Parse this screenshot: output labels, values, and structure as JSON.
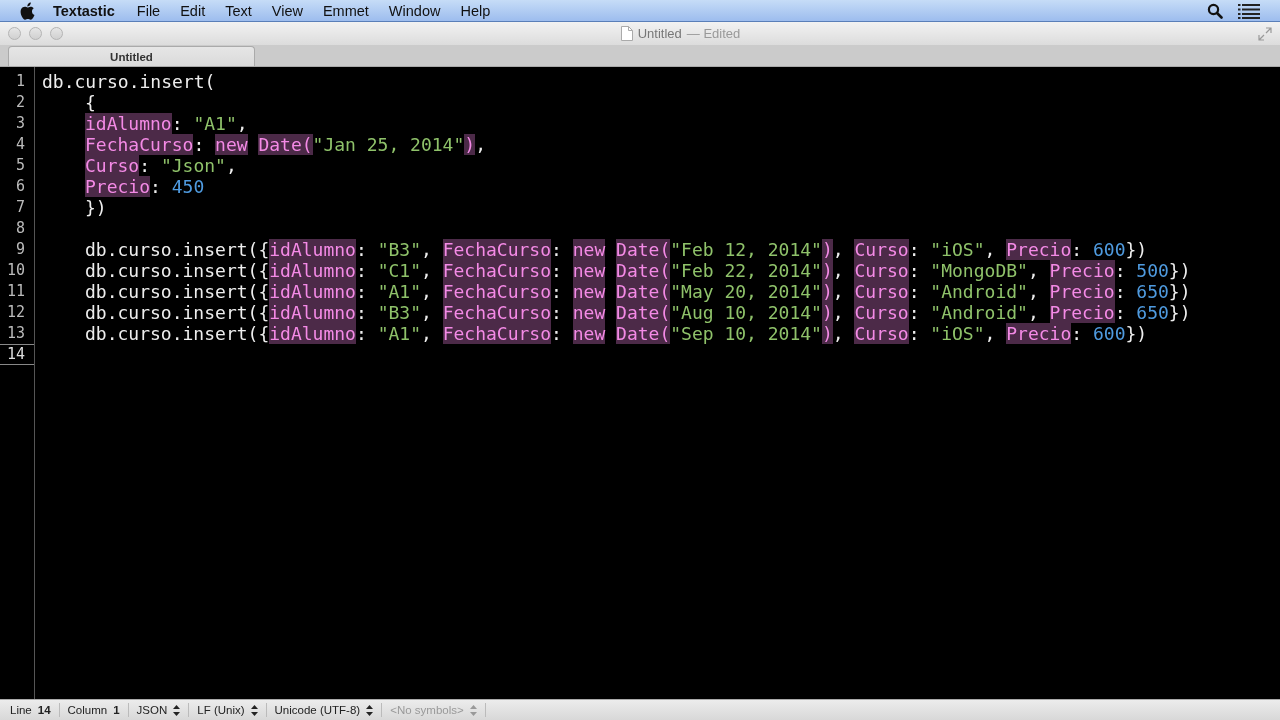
{
  "menu_bar": {
    "app_name": "Textastic",
    "menus": [
      "File",
      "Edit",
      "Text",
      "View",
      "Emmet",
      "Window",
      "Help"
    ]
  },
  "window": {
    "title": "Untitled",
    "title_status": "— Edited"
  },
  "tabs": [
    {
      "label": "Untitled",
      "selected": true
    }
  ],
  "editor": {
    "lines": [
      {
        "number": "1",
        "current": false,
        "indented": false,
        "tokens": [
          {
            "kind": "plain",
            "text": "db.curso.insert("
          }
        ]
      },
      {
        "number": "2",
        "current": false,
        "indented": true,
        "tokens": [
          {
            "kind": "plain",
            "text": "{"
          }
        ]
      },
      {
        "number": "3",
        "current": false,
        "indented": true,
        "tokens": [
          {
            "kind": "key",
            "text": "idAlumno"
          },
          {
            "kind": "plain",
            "text": ": "
          },
          {
            "kind": "string",
            "text": "\"A1\""
          },
          {
            "kind": "plain",
            "text": ","
          }
        ]
      },
      {
        "number": "4",
        "current": false,
        "indented": true,
        "tokens": [
          {
            "kind": "key",
            "text": "FechaCurso"
          },
          {
            "kind": "plain",
            "text": ": "
          },
          {
            "kind": "key",
            "text": "new"
          },
          {
            "kind": "key",
            "text": "Date(",
            "space_before": true
          },
          {
            "kind": "string",
            "text": "\"Jan 25, 2014\""
          },
          {
            "kind": "key",
            "text": ")"
          },
          {
            "kind": "plain",
            "text": ","
          }
        ]
      },
      {
        "number": "5",
        "current": false,
        "indented": true,
        "tokens": [
          {
            "kind": "key",
            "text": "Curso"
          },
          {
            "kind": "plain",
            "text": ": "
          },
          {
            "kind": "string",
            "text": "\"Json\""
          },
          {
            "kind": "plain",
            "text": ","
          }
        ]
      },
      {
        "number": "6",
        "current": false,
        "indented": true,
        "tokens": [
          {
            "kind": "key",
            "text": "Precio"
          },
          {
            "kind": "plain",
            "text": ": "
          },
          {
            "kind": "number",
            "text": "450"
          }
        ]
      },
      {
        "number": "7",
        "current": false,
        "indented": true,
        "tokens": [
          {
            "kind": "plain",
            "text": "})"
          }
        ]
      },
      {
        "number": "8",
        "current": false,
        "indented": false
      },
      {
        "number": "9",
        "current": false,
        "indented": true,
        "tokens": [
          {
            "kind": "plain",
            "text": "db.curso.insert({"
          },
          {
            "kind": "key",
            "text": "idAlumno"
          },
          {
            "kind": "plain",
            "text": ": "
          },
          {
            "kind": "string",
            "text": "\"B3\""
          },
          {
            "kind": "plain",
            "text": ", "
          },
          {
            "kind": "key",
            "text": "FechaCurso"
          },
          {
            "kind": "plain",
            "text": ": "
          },
          {
            "kind": "key",
            "text": "new"
          },
          {
            "kind": "key",
            "text": "Date(",
            "space_before": true
          },
          {
            "kind": "string",
            "text": "\"Feb 12, 2014\""
          },
          {
            "kind": "key",
            "text": ")"
          },
          {
            "kind": "plain",
            "text": ", "
          },
          {
            "kind": "key",
            "text": "Curso"
          },
          {
            "kind": "plain",
            "text": ": "
          },
          {
            "kind": "string",
            "text": "\"iOS\""
          },
          {
            "kind": "plain",
            "text": ", "
          },
          {
            "kind": "key",
            "text": "Precio"
          },
          {
            "kind": "plain",
            "text": ": "
          },
          {
            "kind": "number",
            "text": "600"
          },
          {
            "kind": "plain",
            "text": "})"
          }
        ]
      },
      {
        "number": "10",
        "current": false,
        "indented": true,
        "tokens": [
          {
            "kind": "plain",
            "text": "db.curso.insert({"
          },
          {
            "kind": "key",
            "text": "idAlumno"
          },
          {
            "kind": "plain",
            "text": ": "
          },
          {
            "kind": "string",
            "text": "\"C1\""
          },
          {
            "kind": "plain",
            "text": ", "
          },
          {
            "kind": "key",
            "text": "FechaCurso"
          },
          {
            "kind": "plain",
            "text": ": "
          },
          {
            "kind": "key",
            "text": "new"
          },
          {
            "kind": "key",
            "text": "Date(",
            "space_before": true
          },
          {
            "kind": "string",
            "text": "\"Feb 22, 2014\""
          },
          {
            "kind": "key",
            "text": ")"
          },
          {
            "kind": "plain",
            "text": ", "
          },
          {
            "kind": "key",
            "text": "Curso"
          },
          {
            "kind": "plain",
            "text": ": "
          },
          {
            "kind": "string",
            "text": "\"MongoDB\""
          },
          {
            "kind": "plain",
            "text": ", "
          },
          {
            "kind": "key",
            "text": "Precio"
          },
          {
            "kind": "plain",
            "text": ": "
          },
          {
            "kind": "number",
            "text": "500"
          },
          {
            "kind": "plain",
            "text": "})"
          }
        ]
      },
      {
        "number": "11",
        "current": false,
        "indented": true,
        "tokens": [
          {
            "kind": "plain",
            "text": "db.curso.insert({"
          },
          {
            "kind": "key",
            "text": "idAlumno"
          },
          {
            "kind": "plain",
            "text": ": "
          },
          {
            "kind": "string",
            "text": "\"A1\""
          },
          {
            "kind": "plain",
            "text": ", "
          },
          {
            "kind": "key",
            "text": "FechaCurso"
          },
          {
            "kind": "plain",
            "text": ": "
          },
          {
            "kind": "key",
            "text": "new"
          },
          {
            "kind": "key",
            "text": "Date(",
            "space_before": true
          },
          {
            "kind": "string",
            "text": "\"May 20, 2014\""
          },
          {
            "kind": "key",
            "text": ")"
          },
          {
            "kind": "plain",
            "text": ", "
          },
          {
            "kind": "key",
            "text": "Curso"
          },
          {
            "kind": "plain",
            "text": ": "
          },
          {
            "kind": "string",
            "text": "\"Android\""
          },
          {
            "kind": "plain",
            "text": ", "
          },
          {
            "kind": "key",
            "text": "Precio"
          },
          {
            "kind": "plain",
            "text": ": "
          },
          {
            "kind": "number",
            "text": "650"
          },
          {
            "kind": "plain",
            "text": "})"
          }
        ]
      },
      {
        "number": "12",
        "current": false,
        "indented": true,
        "tokens": [
          {
            "kind": "plain",
            "text": "db.curso.insert({"
          },
          {
            "kind": "key",
            "text": "idAlumno"
          },
          {
            "kind": "plain",
            "text": ": "
          },
          {
            "kind": "string",
            "text": "\"B3\""
          },
          {
            "kind": "plain",
            "text": ", "
          },
          {
            "kind": "key",
            "text": "FechaCurso"
          },
          {
            "kind": "plain",
            "text": ": "
          },
          {
            "kind": "key",
            "text": "new"
          },
          {
            "kind": "key",
            "text": "Date(",
            "space_before": true
          },
          {
            "kind": "string",
            "text": "\"Aug 10, 2014\""
          },
          {
            "kind": "key",
            "text": ")"
          },
          {
            "kind": "plain",
            "text": ", "
          },
          {
            "kind": "key",
            "text": "Curso"
          },
          {
            "kind": "plain",
            "text": ": "
          },
          {
            "kind": "string",
            "text": "\"Android\""
          },
          {
            "kind": "plain",
            "text": ", "
          },
          {
            "kind": "key",
            "text": "Precio"
          },
          {
            "kind": "plain",
            "text": ": "
          },
          {
            "kind": "number",
            "text": "650"
          },
          {
            "kind": "plain",
            "text": "})"
          }
        ]
      },
      {
        "number": "13",
        "current": false,
        "indented": true,
        "tokens": [
          {
            "kind": "plain",
            "text": "db.curso.insert({"
          },
          {
            "kind": "key",
            "text": "idAlumno"
          },
          {
            "kind": "plain",
            "text": ": "
          },
          {
            "kind": "string",
            "text": "\"A1\""
          },
          {
            "kind": "plain",
            "text": ", "
          },
          {
            "kind": "key",
            "text": "FechaCurso"
          },
          {
            "kind": "plain",
            "text": ": "
          },
          {
            "kind": "key",
            "text": "new"
          },
          {
            "kind": "key",
            "text": "Date(",
            "space_before": true
          },
          {
            "kind": "string",
            "text": "\"Sep 10, 2014\""
          },
          {
            "kind": "key",
            "text": ")"
          },
          {
            "kind": "plain",
            "text": ", "
          },
          {
            "kind": "key",
            "text": "Curso"
          },
          {
            "kind": "plain",
            "text": ": "
          },
          {
            "kind": "string",
            "text": "\"iOS\""
          },
          {
            "kind": "plain",
            "text": ", "
          },
          {
            "kind": "key",
            "text": "Precio"
          },
          {
            "kind": "plain",
            "text": ": "
          },
          {
            "kind": "number",
            "text": "600"
          },
          {
            "kind": "plain",
            "text": "})"
          }
        ]
      },
      {
        "number": "14",
        "current": true,
        "indented": false
      }
    ]
  },
  "status_bar": [
    {
      "kind": "text",
      "text": "Line **14**",
      "disabled": false
    },
    {
      "kind": "text",
      "text": "Column **1**",
      "disabled": false
    },
    {
      "kind": "popup",
      "text": "JSON",
      "disabled": false
    },
    {
      "kind": "popup",
      "text": "LF (Unix)",
      "disabled": false
    },
    {
      "kind": "popup",
      "text": "Unicode (UTF-8)",
      "disabled": false
    },
    {
      "kind": "popup",
      "text": "<No symbols>",
      "disabled": true
    }
  ]
}
